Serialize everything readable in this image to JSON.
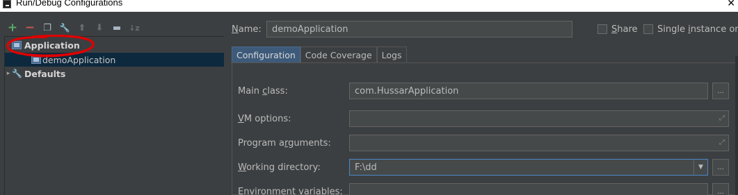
{
  "window": {
    "title": "Run/Debug Configurations",
    "close": "✕"
  },
  "toolbar": {
    "add": "+",
    "remove": "−",
    "copy": "❐",
    "edit_defaults": "🔧",
    "move_up": "⬆",
    "move_down": "⬇",
    "folder": "▬",
    "sort": "↓z"
  },
  "tree": {
    "application": {
      "label": "Application",
      "arrow": "▾"
    },
    "demo": {
      "label": "demoApplication"
    },
    "defaults": {
      "label": "Defaults",
      "arrow": "▸"
    }
  },
  "form": {
    "name_label_u": "N",
    "name_label_rest": "ame:",
    "name_value": "demoApplication",
    "share_label_u": "S",
    "share_label_rest": "hare",
    "single_label_a": "Single ",
    "single_label_u": "i",
    "single_label_rest": "nstance only"
  },
  "tabs": [
    "Configuration",
    "Code Coverage",
    "Logs"
  ],
  "config": {
    "main_class_label_a": "Main ",
    "main_class_label_u": "c",
    "main_class_label_rest": "lass:",
    "main_class_value": "com.HussarApplication",
    "vm_options_label_u": "V",
    "vm_options_label_rest": "M options:",
    "program_args_label_a": "Program a",
    "program_args_label_u": "r",
    "program_args_label_rest": "guments:",
    "working_dir_label_u": "W",
    "working_dir_label_rest": "orking directory:",
    "working_dir_value": "F:\\dd",
    "env_vars_label_u": "E",
    "env_vars_label_rest": "nvironment variables:",
    "browse": "...",
    "expand": "⤢",
    "dropdown": "▼"
  },
  "colors": {
    "add": "#59a869",
    "remove": "#c75450",
    "annotation": "#e00000",
    "accent": "#4a88c7"
  }
}
